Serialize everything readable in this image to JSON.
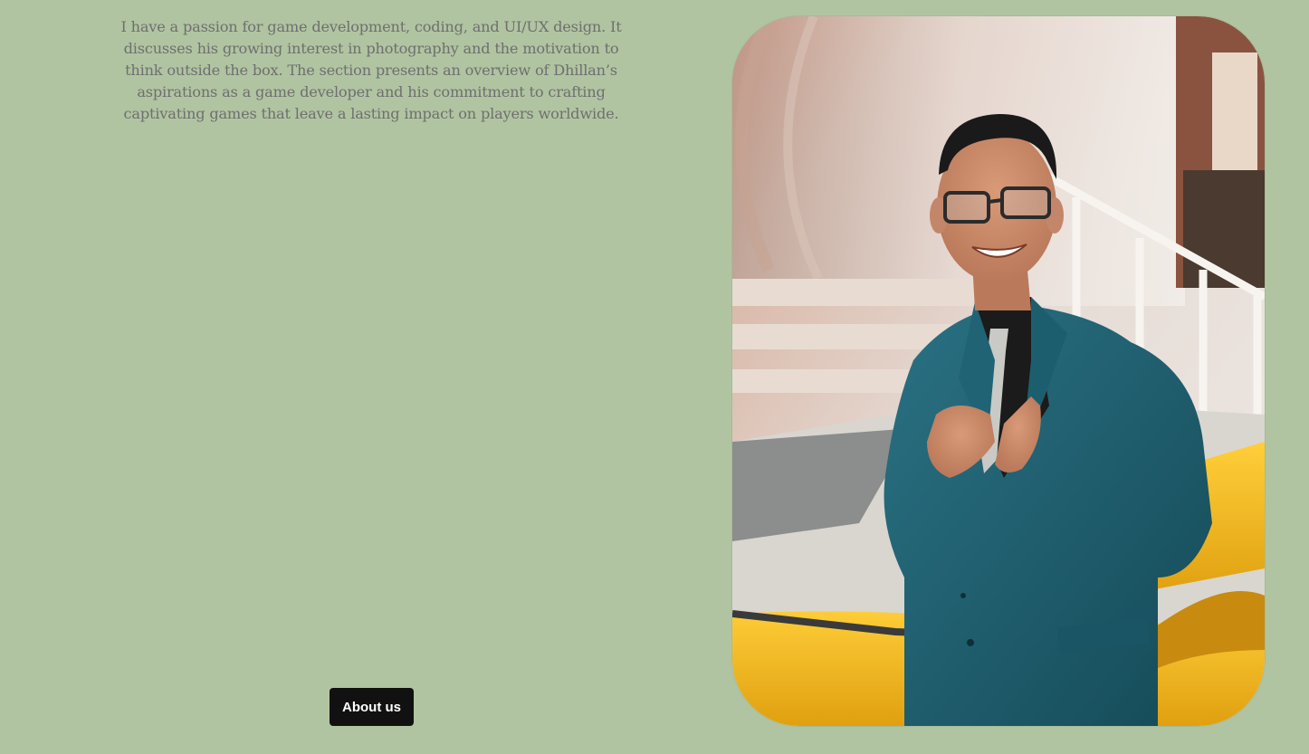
{
  "about": {
    "description": "I have a passion for game development, coding, and UI/UX design. It discusses his growing interest in photography and the motivation to think outside the box. The section presents an overview of Dhillan’s aspirations as a game developer and his commitment to crafting captivating games that leave a lasting impact on players worldwide.",
    "button_label": "About us"
  },
  "photo": {
    "icon": "portrait-photo",
    "subject": "man-in-teal-suit"
  },
  "colors": {
    "background": "#b0c4a1",
    "text": "#6f6f6f",
    "button_bg": "#111111",
    "button_text": "#ffffff",
    "suit": "#1f5d6c",
    "car": "#f2b61e"
  }
}
